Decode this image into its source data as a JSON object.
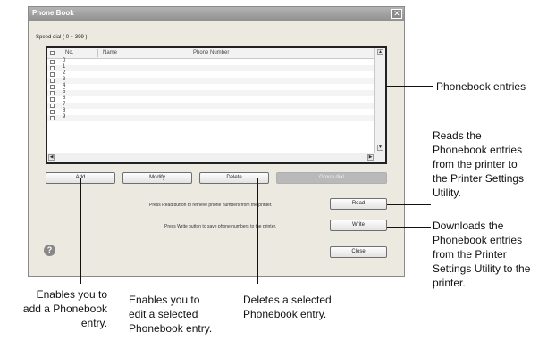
{
  "dialog": {
    "title": "Phone Book",
    "close_glyph": "✕",
    "subtitle": "Speed dial ( 0 ~ 399 )"
  },
  "list": {
    "columns": [
      "No.",
      "Name",
      "Phone Number"
    ],
    "rows": [
      "0",
      "1",
      "2",
      "3",
      "4",
      "5",
      "6",
      "7",
      "8",
      "9"
    ]
  },
  "buttons": {
    "add": "Add",
    "modify": "Modify",
    "delete": "Delete",
    "group_dial": "Group dial",
    "read": "Read",
    "write": "Write",
    "close": "Close"
  },
  "notes": {
    "read": "Press Read button to retrieve phone numbers from the printer.",
    "write": "Press Write button to save phone numbers to the printer."
  },
  "icons": {
    "help": "help-icon",
    "help_glyph": "?"
  },
  "callouts": {
    "phonebook_entries": [
      "Phonebook entries"
    ],
    "read": [
      "Reads the",
      "Phonebook entries",
      "from the printer to",
      "the Printer Settings",
      "Utility."
    ],
    "write": [
      "Downloads the",
      "Phonebook entries",
      "from the Printer",
      "Settings Utility to the",
      "printer."
    ],
    "add": [
      "Enables you to",
      "add a Phonebook",
      "entry."
    ],
    "modify": [
      "Enables you to",
      "edit a selected",
      "Phonebook entry."
    ],
    "delete": [
      "Deletes a selected",
      "Phonebook entry."
    ]
  }
}
